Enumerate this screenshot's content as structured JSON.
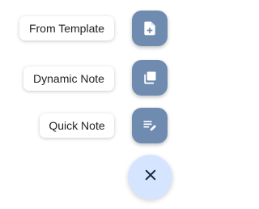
{
  "fab_menu": {
    "items": [
      {
        "label": "From Template",
        "icon": "note-add-icon"
      },
      {
        "label": "Dynamic Note",
        "icon": "library-notes-icon"
      },
      {
        "label": "Quick Note",
        "icon": "edit-note-icon"
      }
    ],
    "main_button": {
      "icon": "close-icon"
    },
    "colors": {
      "mini_fab_bg": "#6f8bb0",
      "main_fab_bg": "#d6e5ff",
      "icon_dark": "#1d2a3a",
      "label_text": "#1f1f1f"
    }
  }
}
